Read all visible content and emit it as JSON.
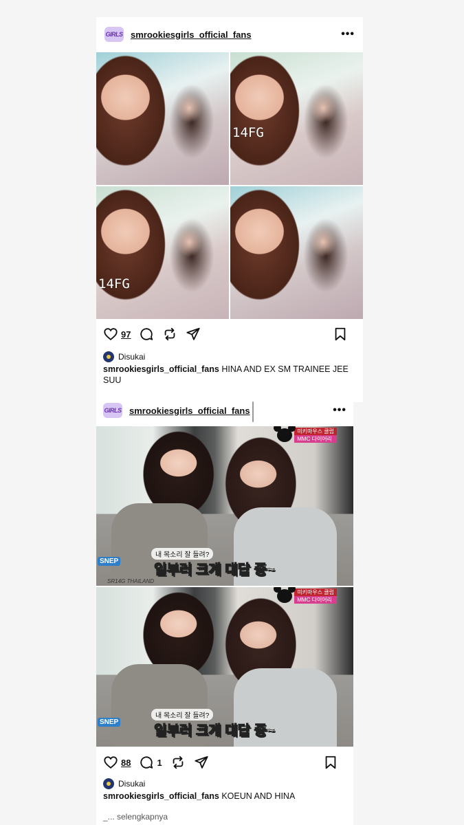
{
  "post1": {
    "avatar_text": "GIRLS",
    "username": "smrookiesgirls_official_fans",
    "photo_watermarks": [
      "14FG",
      "14FG"
    ],
    "likes": "97",
    "liked_by": "Disukai",
    "caption_user": "smrookiesgirls_official_fans",
    "caption_text": "HINA AND EX SM TRAINEE JEE SUU",
    "more": "_"
  },
  "post2": {
    "avatar_text": "GIRLS",
    "username": "smrookiesgirls_official_fans",
    "tv_logo_line1": "미키마우스 클럽",
    "tv_logo_line2": "MMC 다이어리",
    "subtitle_small": "내 목소리 잘 들려?",
    "subtitle_big_pre": "일부러 ",
    "subtitle_big_pink": "크게",
    "subtitle_big_post": " 대답 중~",
    "channel": "SNEP",
    "frame_tag": "SR14G THAILAND",
    "likes": "88",
    "comments": "1",
    "liked_by": "Disukai",
    "caption_user": "smrookiesgirls_official_fans",
    "caption_text": "KOEUN AND HINA",
    "more": "_... selengkapnya"
  },
  "icons": [
    "more-icon",
    "heart-icon",
    "comment-icon",
    "repost-icon",
    "share-icon",
    "bookmark-icon"
  ],
  "colors": {
    "tv_logo_red": "#c0242e",
    "tv_logo_pink": "#d93e8e",
    "subtitle_pink": "#ff5fa0"
  }
}
